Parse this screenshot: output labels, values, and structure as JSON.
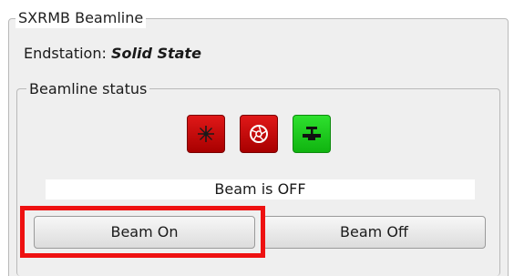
{
  "sxrmb_group": {
    "title": "SXRMB Beamline",
    "endstation_label": "Endstation:",
    "endstation_value": "Solid State"
  },
  "beamline_status": {
    "title": "Beamline status",
    "indicators": [
      {
        "icon": "beam-shutter-icon",
        "state": "red"
      },
      {
        "icon": "photon-shutter-icon",
        "state": "red"
      },
      {
        "icon": "valve-icon",
        "state": "green"
      }
    ],
    "beam_state_text": "Beam is OFF",
    "beam_on_label": "Beam On",
    "beam_off_label": "Beam Off"
  },
  "colors": {
    "indicator_red": "#c00000",
    "indicator_green": "#1ccc1c",
    "highlight": "#ee1111"
  }
}
